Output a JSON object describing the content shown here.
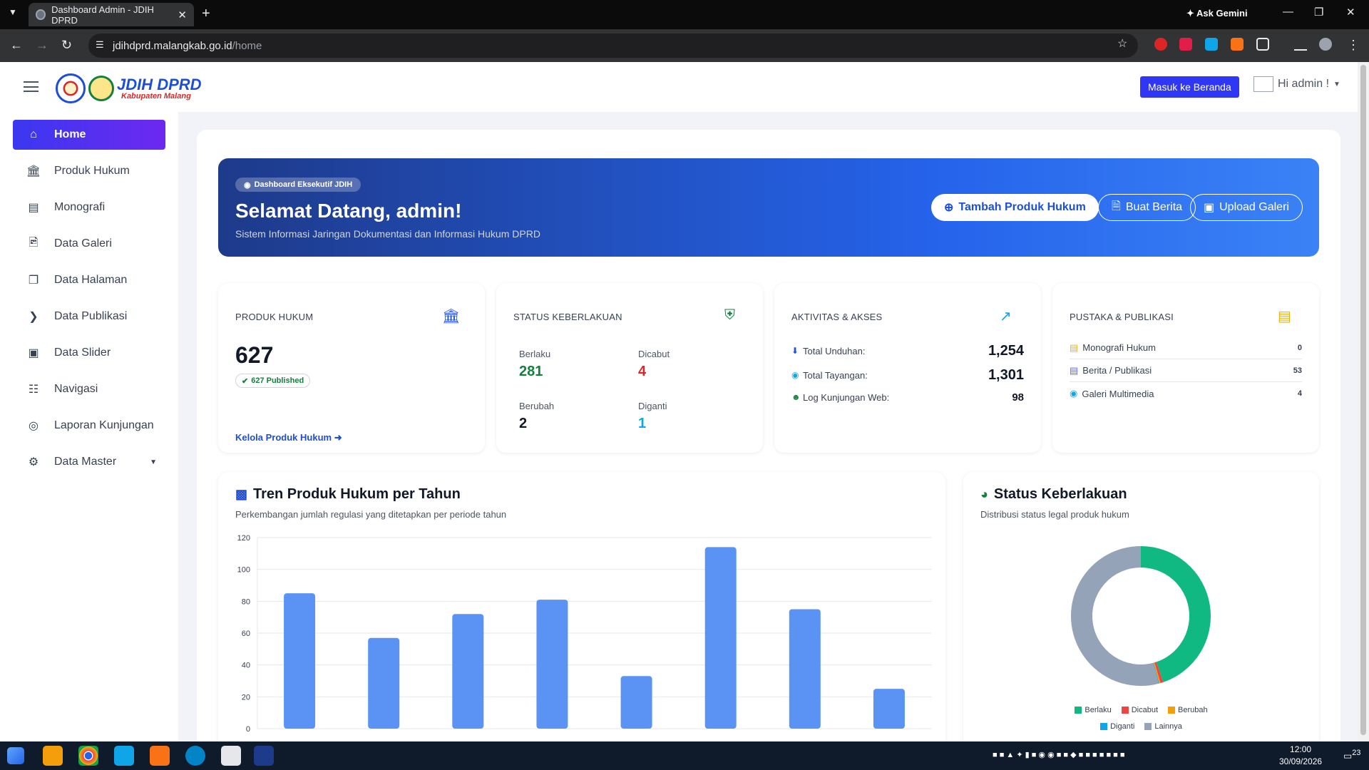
{
  "browser": {
    "tab_title": "Dashboard Admin - JDIH DPRD",
    "url_host": "jdihdprd.malangkab.go.id",
    "url_path": "/home",
    "gemini_label": "Ask Gemini"
  },
  "header": {
    "logo_title": "JDIH DPRD",
    "logo_subtitle": "Kabupaten Malang",
    "beranda_button": "Masuk ke Beranda",
    "user_greeting": "Hi admin !"
  },
  "sidebar": {
    "items": [
      {
        "label": "Home",
        "icon": "home-icon"
      },
      {
        "label": "Produk Hukum",
        "icon": "bank-icon"
      },
      {
        "label": "Monografi",
        "icon": "book-icon"
      },
      {
        "label": "Data Galeri",
        "icon": "image-file-icon"
      },
      {
        "label": "Data Halaman",
        "icon": "copy-icon"
      },
      {
        "label": "Data Publikasi",
        "icon": "rss-icon"
      },
      {
        "label": "Data Slider",
        "icon": "picture-icon"
      },
      {
        "label": "Navigasi",
        "icon": "sitemap-icon"
      },
      {
        "label": "Laporan Kunjungan",
        "icon": "target-icon"
      },
      {
        "label": "Data Master",
        "icon": "gear-icon"
      }
    ]
  },
  "hero": {
    "pill": "Dashboard Eksekutif JDIH",
    "title": "Selamat Datang, admin!",
    "subtitle": "Sistem Informasi Jaringan Dokumentasi dan Informasi Hukum DPRD",
    "btn_produk": "Tambah Produk Hukum",
    "btn_berita": "Buat Berita",
    "btn_galeri": "Upload Galeri"
  },
  "cards": {
    "produk": {
      "title": "PRODUK HUKUM",
      "value": "627",
      "badge": "627 Published",
      "link": "Kelola Produk Hukum"
    },
    "status": {
      "title": "STATUS KEBERLAKUAN",
      "berlaku_label": "Berlaku",
      "berlaku": "281",
      "dicabut_label": "Dicabut",
      "dicabut": "4",
      "berubah_label": "Berubah",
      "berubah": "2",
      "diganti_label": "Diganti",
      "diganti": "1"
    },
    "aktivitas": {
      "title": "AKTIVITAS & AKSES",
      "unduhan_label": "Total Unduhan:",
      "unduhan": "1,254",
      "tayangan_label": "Total Tayangan:",
      "tayangan": "1,301",
      "log_label": "Log Kunjungan Web:",
      "log": "98"
    },
    "pustaka": {
      "title": "PUSTAKA & PUBLIKASI",
      "monografi_label": "Monografi Hukum",
      "monografi": "0",
      "berita_label": "Berita / Publikasi",
      "berita": "53",
      "galeri_label": "Galeri Multimedia",
      "galeri": "4"
    }
  },
  "trend": {
    "title": "Tren Produk Hukum per Tahun",
    "subtitle": "Perkembangan jumlah regulasi yang ditetapkan per periode tahun"
  },
  "status_panel": {
    "title": "Status Keberlakuan",
    "subtitle": "Distribusi status legal produk hukum"
  },
  "colors": {
    "primary": "#2563eb",
    "bar": "#5b93f5",
    "berlaku": "#10b981",
    "dicabut": "#ef4444",
    "berubah": "#f59e0b",
    "diganti": "#0ea5e9",
    "lainnya": "#94a3b8"
  },
  "chart_data": [
    {
      "type": "bar",
      "title": "Tren Produk Hukum per Tahun",
      "categories": [
        "",
        "",
        "",
        "",
        "",
        "",
        "",
        ""
      ],
      "values": [
        85,
        57,
        72,
        81,
        33,
        114,
        75,
        25
      ],
      "yticks": [
        "0",
        "20",
        "40",
        "60",
        "80",
        "100",
        "120"
      ],
      "ylim": [
        0,
        120
      ],
      "grid": true
    },
    {
      "type": "pie",
      "title": "Status Keberlakuan",
      "labels": [
        "Berlaku",
        "Dicabut",
        "Berubah",
        "Diganti",
        "Lainnya"
      ],
      "values": [
        281,
        4,
        2,
        1,
        339
      ],
      "legend": "bottom"
    }
  ],
  "taskbar": {
    "time": "12:00",
    "date": "30/09/2026",
    "notif": "23"
  }
}
